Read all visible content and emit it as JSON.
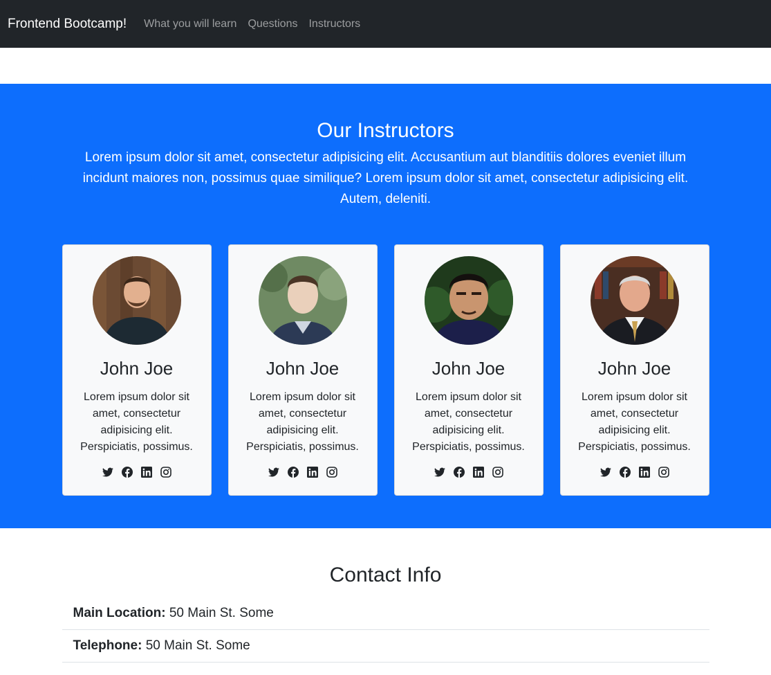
{
  "nav": {
    "brand": "Frontend Bootcamp!",
    "links": [
      "What you will learn",
      "Questions",
      "Instructors"
    ]
  },
  "instructors": {
    "title": "Our Instructors",
    "lead": "Lorem ipsum dolor sit amet, consectetur adipisicing elit. Accusantium aut blanditiis dolores eveniet illum incidunt maiores non, possimus quae similique? Lorem ipsum dolor sit amet, consectetur adipisicing elit. Autem, deleniti.",
    "cards": [
      {
        "name": "John Joe",
        "text": "Lorem ipsum dolor sit amet, consectetur adipisicing elit. Perspiciatis, possimus."
      },
      {
        "name": "John Joe",
        "text": "Lorem ipsum dolor sit amet, consectetur adipisicing elit. Perspiciatis, possimus."
      },
      {
        "name": "John Joe",
        "text": "Lorem ipsum dolor sit amet, consectetur adipisicing elit. Perspiciatis, possimus."
      },
      {
        "name": "John Joe",
        "text": "Lorem ipsum dolor sit amet, consectetur adipisicing elit. Perspiciatis, possimus."
      }
    ],
    "social_icons": [
      "twitter-icon",
      "facebook-icon",
      "linkedin-icon",
      "instagram-icon"
    ]
  },
  "contact": {
    "title": "Contact Info",
    "items": [
      {
        "label": "Main Location:",
        "value": "50 Main St. Some"
      },
      {
        "label": "Telephone:",
        "value": "50 Main St. Some"
      }
    ]
  },
  "colors": {
    "navbar_bg": "#212529",
    "primary": "#0d6efd",
    "card_bg": "#f8f9fa"
  }
}
